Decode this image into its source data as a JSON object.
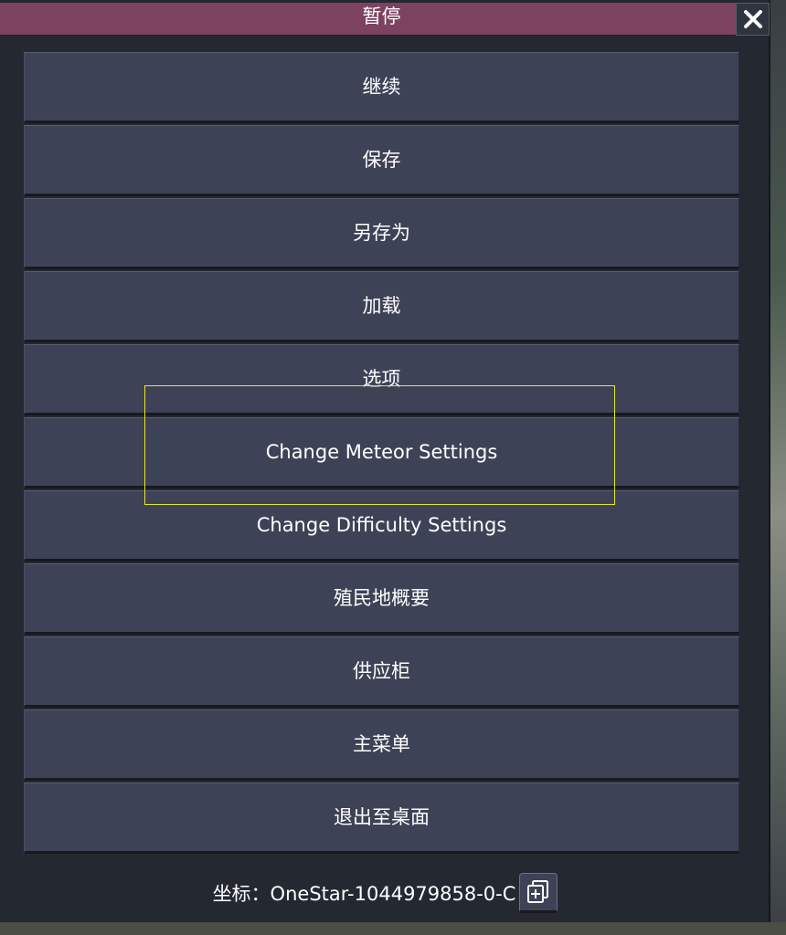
{
  "window": {
    "title": "暂停",
    "close_icon": "close-icon"
  },
  "menu": {
    "items": [
      {
        "id": "resume",
        "label": "继续"
      },
      {
        "id": "save",
        "label": "保存"
      },
      {
        "id": "save-as",
        "label": "另存为"
      },
      {
        "id": "load",
        "label": "加载"
      },
      {
        "id": "options",
        "label": "选项"
      },
      {
        "id": "change-meteor-settings",
        "label": "Change Meteor Settings"
      },
      {
        "id": "change-difficulty-settings",
        "label": "Change Difficulty Settings"
      },
      {
        "id": "colony-summary",
        "label": "殖民地概要"
      },
      {
        "id": "supply-closet",
        "label": "供应柜"
      },
      {
        "id": "main-menu",
        "label": "主菜单"
      },
      {
        "id": "quit-to-desktop",
        "label": "退出至桌面"
      }
    ]
  },
  "footer": {
    "coordinate_text": "坐标：OneStar-1044979858-0-C",
    "copy_icon": "copy-icon"
  },
  "colors": {
    "title_bar": "#7d4260",
    "button": "#3e4257",
    "panel": "#242831",
    "highlight": "#e6e62a"
  }
}
